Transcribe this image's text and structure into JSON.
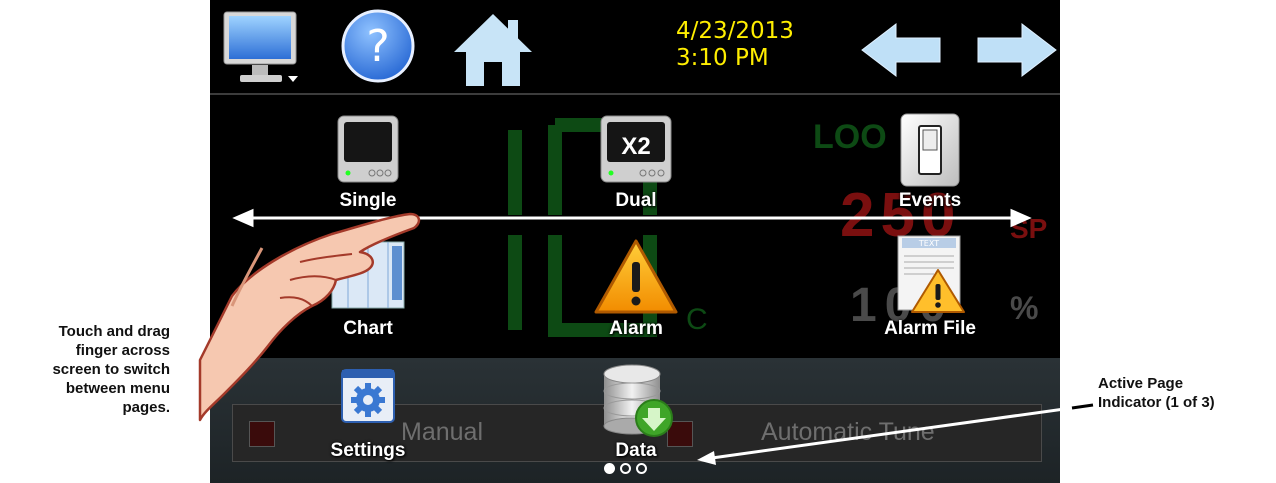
{
  "annotations": {
    "left_lines": [
      "Touch and drag",
      "finger across",
      "screen to switch",
      "between menu",
      "pages."
    ],
    "right_lines": [
      "Active Page",
      "Indicator (1 of 3)"
    ]
  },
  "topbar": {
    "date": "4/23/2013",
    "time": "3:10 PM",
    "icons": [
      "monitor-icon",
      "help-icon",
      "home-icon",
      "back-arrow-icon",
      "forward-arrow-icon"
    ]
  },
  "menu": {
    "items": [
      {
        "label": "Single",
        "icon": "single-display-icon"
      },
      {
        "label": "Dual",
        "icon": "dual-display-icon",
        "badge": "X2"
      },
      {
        "label": "Events",
        "icon": "event-switch-icon"
      },
      {
        "label": "Chart",
        "icon": "chart-icon"
      },
      {
        "label": "Alarm",
        "icon": "alarm-warning-icon"
      },
      {
        "label": "Alarm File",
        "icon": "alarm-file-icon",
        "badge": "TEXT"
      },
      {
        "label": "Settings",
        "icon": "settings-icon"
      },
      {
        "label": "Data",
        "icon": "data-download-icon"
      }
    ]
  },
  "background_display": {
    "loop_label": "LOO",
    "setpoint_value": "250",
    "setpoint_unit": "SP",
    "output_value": "100",
    "output_unit": "%",
    "temp_unit": "C",
    "mode_left": "Manual",
    "mode_right": "Automatic Tune"
  },
  "page_indicator": {
    "current": 1,
    "total": 3
  },
  "colors": {
    "date_text": "#ffee00",
    "background": "#000000",
    "faded_green": "#0d4a14",
    "faded_red": "#7a0f0f"
  }
}
